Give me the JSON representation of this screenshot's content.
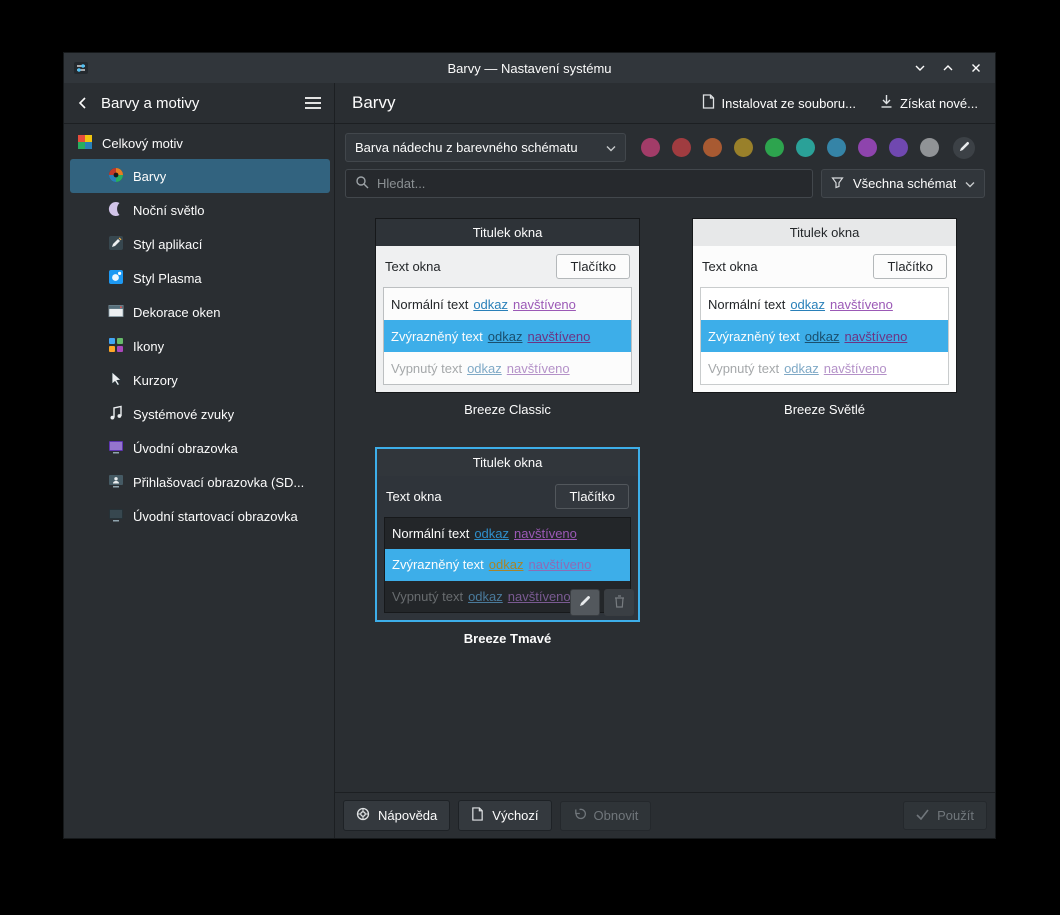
{
  "window": {
    "title": "Barvy — Nastavení systému"
  },
  "sidebar": {
    "header": {
      "title": "Barvy a motivy"
    },
    "section_label": "Celkový motiv",
    "items": [
      {
        "label": "Barvy",
        "selected": true
      },
      {
        "label": "Noční světlo",
        "selected": false
      },
      {
        "label": "Styl aplikací",
        "selected": false
      },
      {
        "label": "Styl Plasma",
        "selected": false
      },
      {
        "label": "Dekorace oken",
        "selected": false
      },
      {
        "label": "Ikony",
        "selected": false
      },
      {
        "label": "Kurzory",
        "selected": false
      },
      {
        "label": "Systémové zvuky",
        "selected": false
      },
      {
        "label": "Úvodní obrazovka",
        "selected": false
      },
      {
        "label": "Přihlašovací obrazovka (SD...",
        "selected": false
      },
      {
        "label": "Úvodní startovací obrazovka",
        "selected": false
      }
    ]
  },
  "main": {
    "title": "Barvy",
    "actions": {
      "install": "Instalovat ze souboru...",
      "get_new": "Získat nové..."
    },
    "accent_dropdown": {
      "value": "Barva nádechu z barevného schématu"
    },
    "accent_swatches": [
      "#a23c68",
      "#a03c40",
      "#a85a32",
      "#99802a",
      "#2da44e",
      "#2aa198",
      "#3584a7",
      "#8e44ad",
      "#7048b0",
      "#909396"
    ],
    "search": {
      "placeholder": "Hledat..."
    },
    "filter_dropdown": {
      "value": "Všechna schémata"
    }
  },
  "preview": {
    "titlebar": "Titulek okna",
    "window_text": "Text okna",
    "button": "Tlačítko",
    "normal_text": "Normální text",
    "link": "odkaz",
    "visited": "navštíveno",
    "highlighted_text": "Zvýrazněný text",
    "disabled_text": "Vypnutý text"
  },
  "schemes": [
    {
      "name": "Breeze Classic",
      "selected": false
    },
    {
      "name": "Breeze Světlé",
      "selected": false
    },
    {
      "name": "Breeze Tmavé",
      "selected": true
    }
  ],
  "footer": {
    "help": "Nápověda",
    "defaults": "Výchozí",
    "reset": "Obnovit",
    "apply": "Použít"
  },
  "colors": {
    "selection": "#3daee9"
  }
}
